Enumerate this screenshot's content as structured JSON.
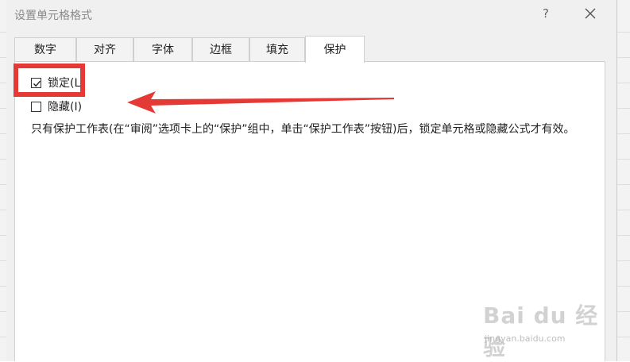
{
  "dialog": {
    "title": "设置单元格格式",
    "help_label": "?"
  },
  "tabs": [
    {
      "label": "数字"
    },
    {
      "label": "对齐"
    },
    {
      "label": "字体"
    },
    {
      "label": "边框"
    },
    {
      "label": "填充"
    },
    {
      "label": "保护"
    }
  ],
  "active_tab": "保护",
  "protection": {
    "locked": {
      "label": "锁定(L)",
      "checked": true
    },
    "hidden": {
      "label": "隐藏(I)",
      "checked": false
    },
    "info": "只有保护工作表(在“审阅”选项卡上的“保护”组中，单击“保护工作表”按钮)后，锁定单元格或隐藏公式才有效。"
  },
  "annotation": {
    "color": "#e53935"
  },
  "watermark": {
    "main": "Bai du 经验",
    "sub": "jingyan.baidu.com"
  }
}
